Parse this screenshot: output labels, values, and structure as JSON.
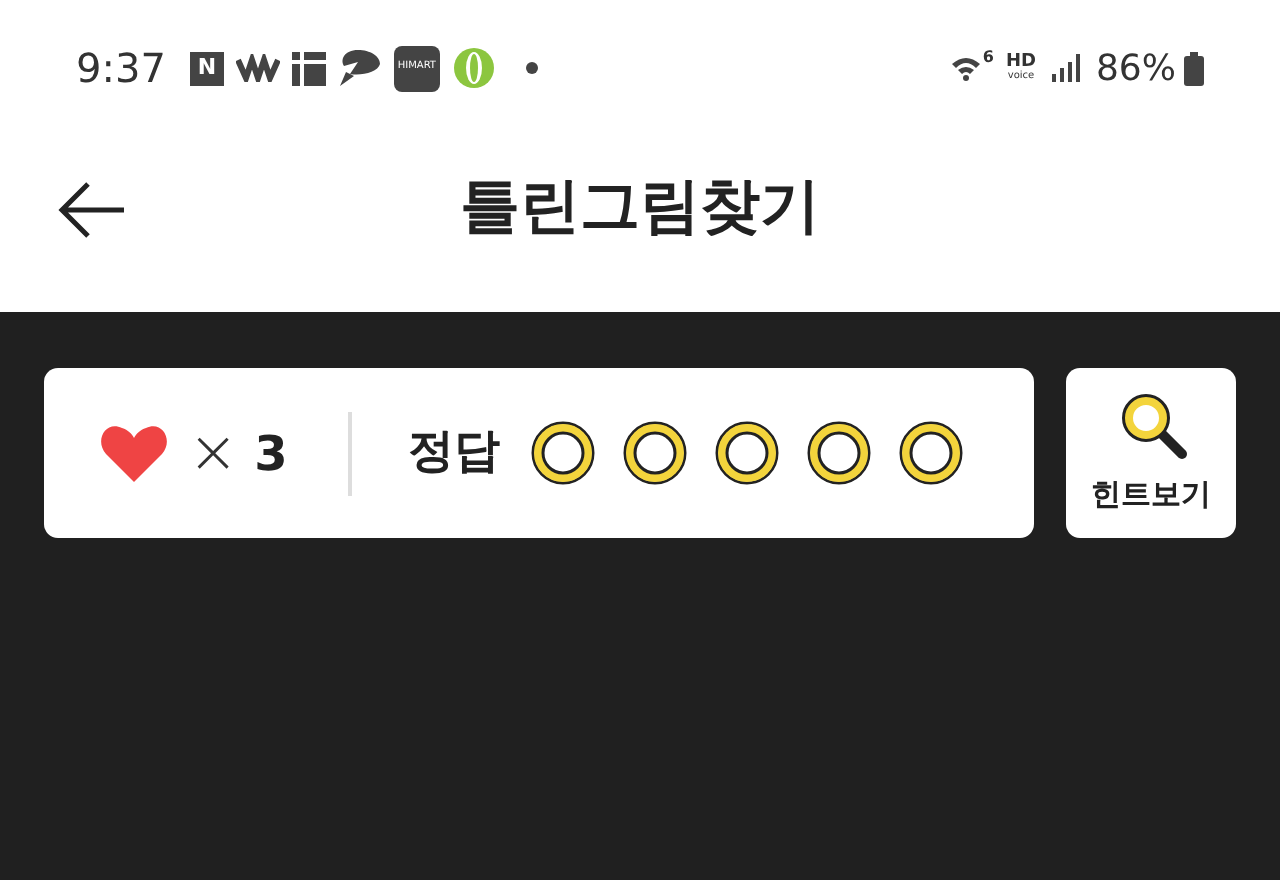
{
  "status_bar": {
    "time": "9:37",
    "app_badges": [
      "N",
      "HIMART"
    ],
    "wifi_generation": "6",
    "hd_voice": {
      "top": "HD",
      "bottom": "voice"
    },
    "battery": "86%"
  },
  "header": {
    "title": "틀린그림찾기"
  },
  "game_bar": {
    "lives_sign": "×",
    "lives": "3",
    "answer_label": "정답",
    "answers": [
      {
        "found": false
      },
      {
        "found": false
      },
      {
        "found": false
      },
      {
        "found": false
      },
      {
        "found": false
      }
    ]
  },
  "hint_button": {
    "label": "힌트보기"
  }
}
